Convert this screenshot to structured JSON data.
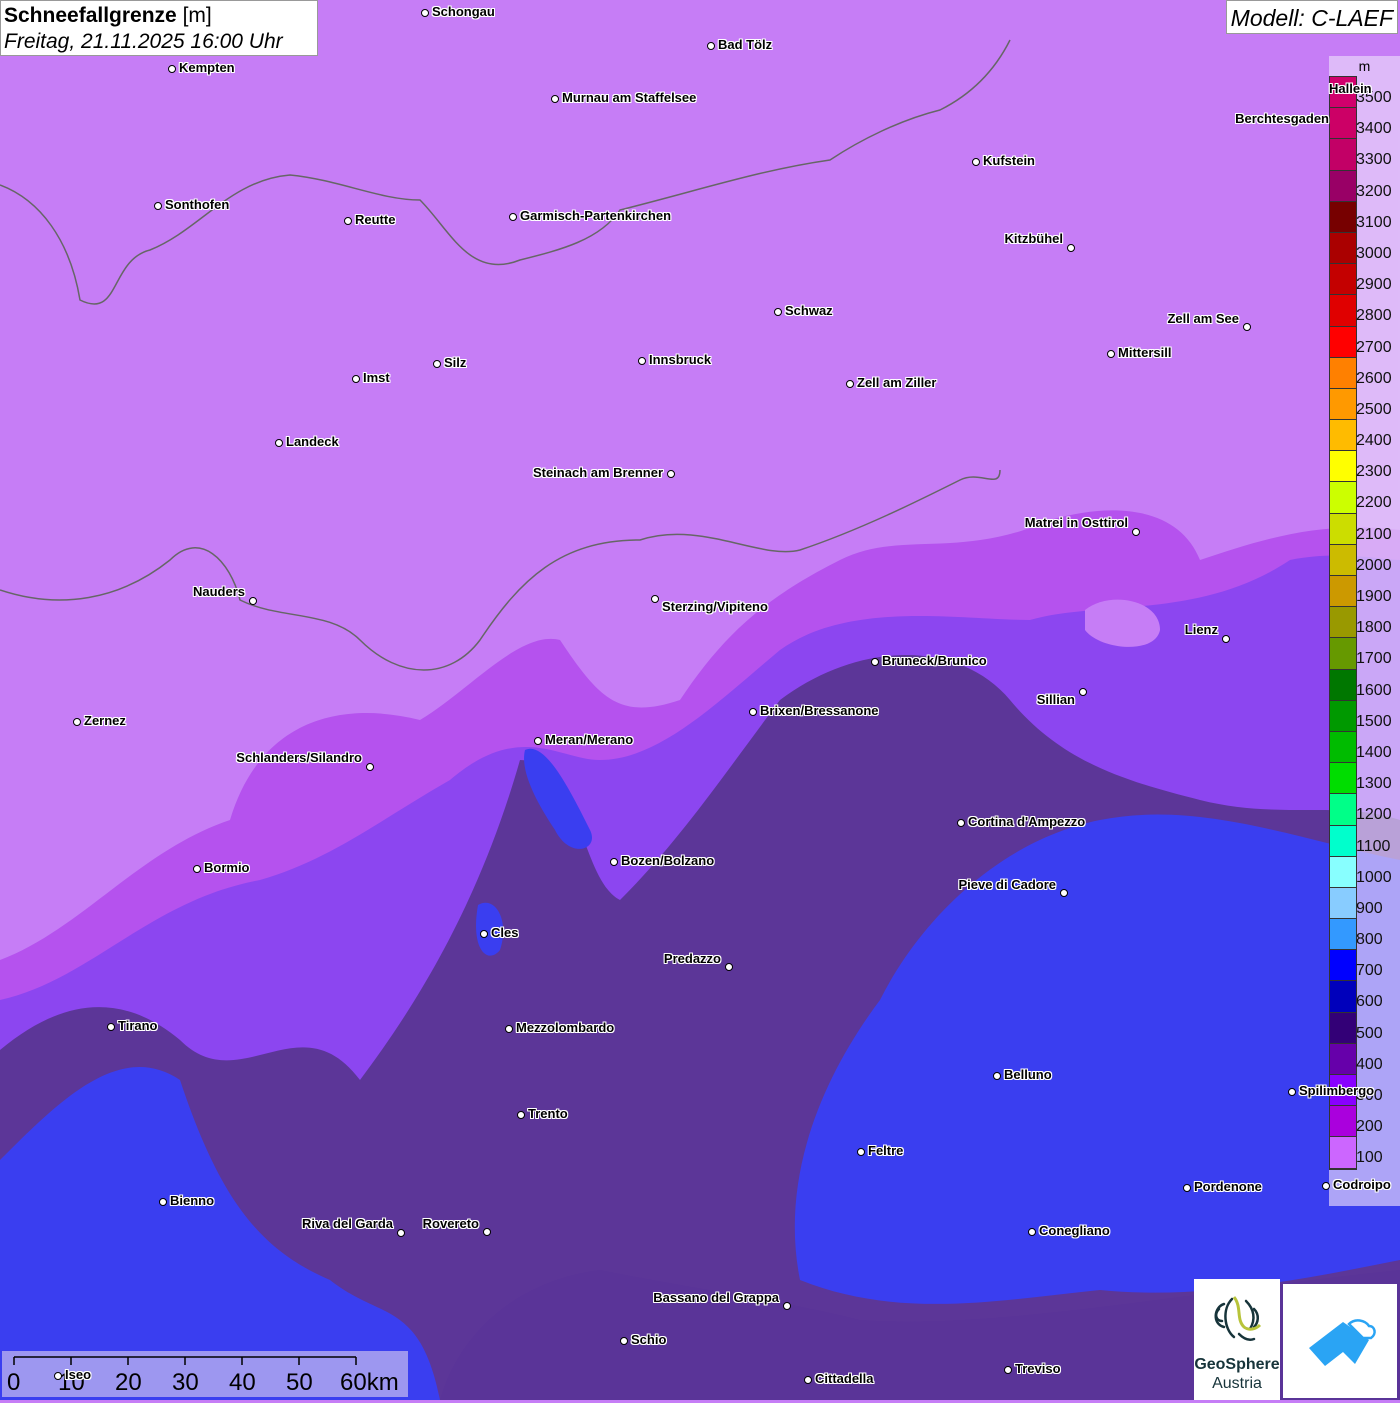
{
  "header": {
    "title": "Schneefallgrenze",
    "unit": "[m]",
    "datetime": "Freitag, 21.11.2025 16:00 Uhr",
    "model": "Modell: C-LAEF"
  },
  "legend": {
    "unit": "m",
    "levels": [
      {
        "value": "3500",
        "color": "#d0006c"
      },
      {
        "value": "3400",
        "color": "#cc0066"
      },
      {
        "value": "3300",
        "color": "#c20066"
      },
      {
        "value": "3200",
        "color": "#990066"
      },
      {
        "value": "3100",
        "color": "#770000"
      },
      {
        "value": "3000",
        "color": "#aa0000"
      },
      {
        "value": "2900",
        "color": "#c40000"
      },
      {
        "value": "2800",
        "color": "#e00000"
      },
      {
        "value": "2700",
        "color": "#ff0000"
      },
      {
        "value": "2600",
        "color": "#ff8000"
      },
      {
        "value": "2500",
        "color": "#ff9900"
      },
      {
        "value": "2400",
        "color": "#ffbb00"
      },
      {
        "value": "2300",
        "color": "#ffff00"
      },
      {
        "value": "2200",
        "color": "#ccff00"
      },
      {
        "value": "2100",
        "color": "#ccdd00"
      },
      {
        "value": "2000",
        "color": "#ccbb00"
      },
      {
        "value": "1900",
        "color": "#cc9900"
      },
      {
        "value": "1800",
        "color": "#999900"
      },
      {
        "value": "1700",
        "color": "#669900"
      },
      {
        "value": "1600",
        "color": "#007700"
      },
      {
        "value": "1500",
        "color": "#009900"
      },
      {
        "value": "1400",
        "color": "#00bb00"
      },
      {
        "value": "1300",
        "color": "#00dd00"
      },
      {
        "value": "1200",
        "color": "#00ff88"
      },
      {
        "value": "1100",
        "color": "#00ffcc"
      },
      {
        "value": "1000",
        "color": "#88ffff"
      },
      {
        "value": "900",
        "color": "#88ccff"
      },
      {
        "value": "800",
        "color": "#3399ff"
      },
      {
        "value": "700",
        "color": "#0000ff"
      },
      {
        "value": "600",
        "color": "#0000bb"
      },
      {
        "value": "500",
        "color": "#330077"
      },
      {
        "value": "400",
        "color": "#6600aa"
      },
      {
        "value": "300",
        "color": "#8800ff"
      },
      {
        "value": "200",
        "color": "#aa00dd"
      },
      {
        "value": "100",
        "color": "#cc66ff"
      }
    ]
  },
  "cities": [
    {
      "name": "Schongau"
    },
    {
      "name": "Bad Tölz"
    },
    {
      "name": "Kempten"
    },
    {
      "name": "Murnau am Staffelsee"
    },
    {
      "name": "Berchtesgaden"
    },
    {
      "name": "Kufstein"
    },
    {
      "name": "Sonthofen"
    },
    {
      "name": "Reutte"
    },
    {
      "name": "Garmisch-Partenkirchen"
    },
    {
      "name": "Kitzbühel"
    },
    {
      "name": "Schwaz"
    },
    {
      "name": "Zell am See"
    },
    {
      "name": "Mittersill"
    },
    {
      "name": "Innsbruck"
    },
    {
      "name": "Silz"
    },
    {
      "name": "Imst"
    },
    {
      "name": "Zell am Ziller"
    },
    {
      "name": "Landeck"
    },
    {
      "name": "Steinach am Brenner"
    },
    {
      "name": "Matrei in Osttirol"
    },
    {
      "name": "Nauders"
    },
    {
      "name": "Sterzing/Vipiteno"
    },
    {
      "name": "Lienz"
    },
    {
      "name": "Bruneck/Brunico"
    },
    {
      "name": "Sillian"
    },
    {
      "name": "Brixen/Bressanone"
    },
    {
      "name": "Zernez"
    },
    {
      "name": "Meran/Merano"
    },
    {
      "name": "Schlanders/Silandro"
    },
    {
      "name": "Cortina d'Ampezzo"
    },
    {
      "name": "Bozen/Bolzano"
    },
    {
      "name": "Bormio"
    },
    {
      "name": "Pieve di Cadore"
    },
    {
      "name": "Cles"
    },
    {
      "name": "Predazzo"
    },
    {
      "name": "Tirano"
    },
    {
      "name": "Mezzolombardo"
    },
    {
      "name": "Belluno"
    },
    {
      "name": "Spilimbergo"
    },
    {
      "name": "Trento"
    },
    {
      "name": "Feltre"
    },
    {
      "name": "Pordenone"
    },
    {
      "name": "Codroipo"
    },
    {
      "name": "Bienno"
    },
    {
      "name": "Riva del Garda"
    },
    {
      "name": "Rovereto"
    },
    {
      "name": "Conegliano"
    },
    {
      "name": "Bassano del Grappa"
    },
    {
      "name": "Schio"
    },
    {
      "name": "Treviso"
    },
    {
      "name": "Cittadella"
    },
    {
      "name": "Iseo"
    },
    {
      "name": "Hallein"
    }
  ],
  "scale_bar": {
    "ticks": [
      "0",
      "10",
      "20",
      "30",
      "40",
      "50",
      "60km"
    ]
  },
  "logos": {
    "geosphere_line1": "GeoSphere",
    "geosphere_line2": "Austria"
  },
  "colors": {
    "map_base": "#c67df6",
    "magenta": "#b050ee",
    "purple": "#8844ee",
    "dark_purple": "#5a3496",
    "blue": "#3a3ef0",
    "border": "#666666"
  }
}
